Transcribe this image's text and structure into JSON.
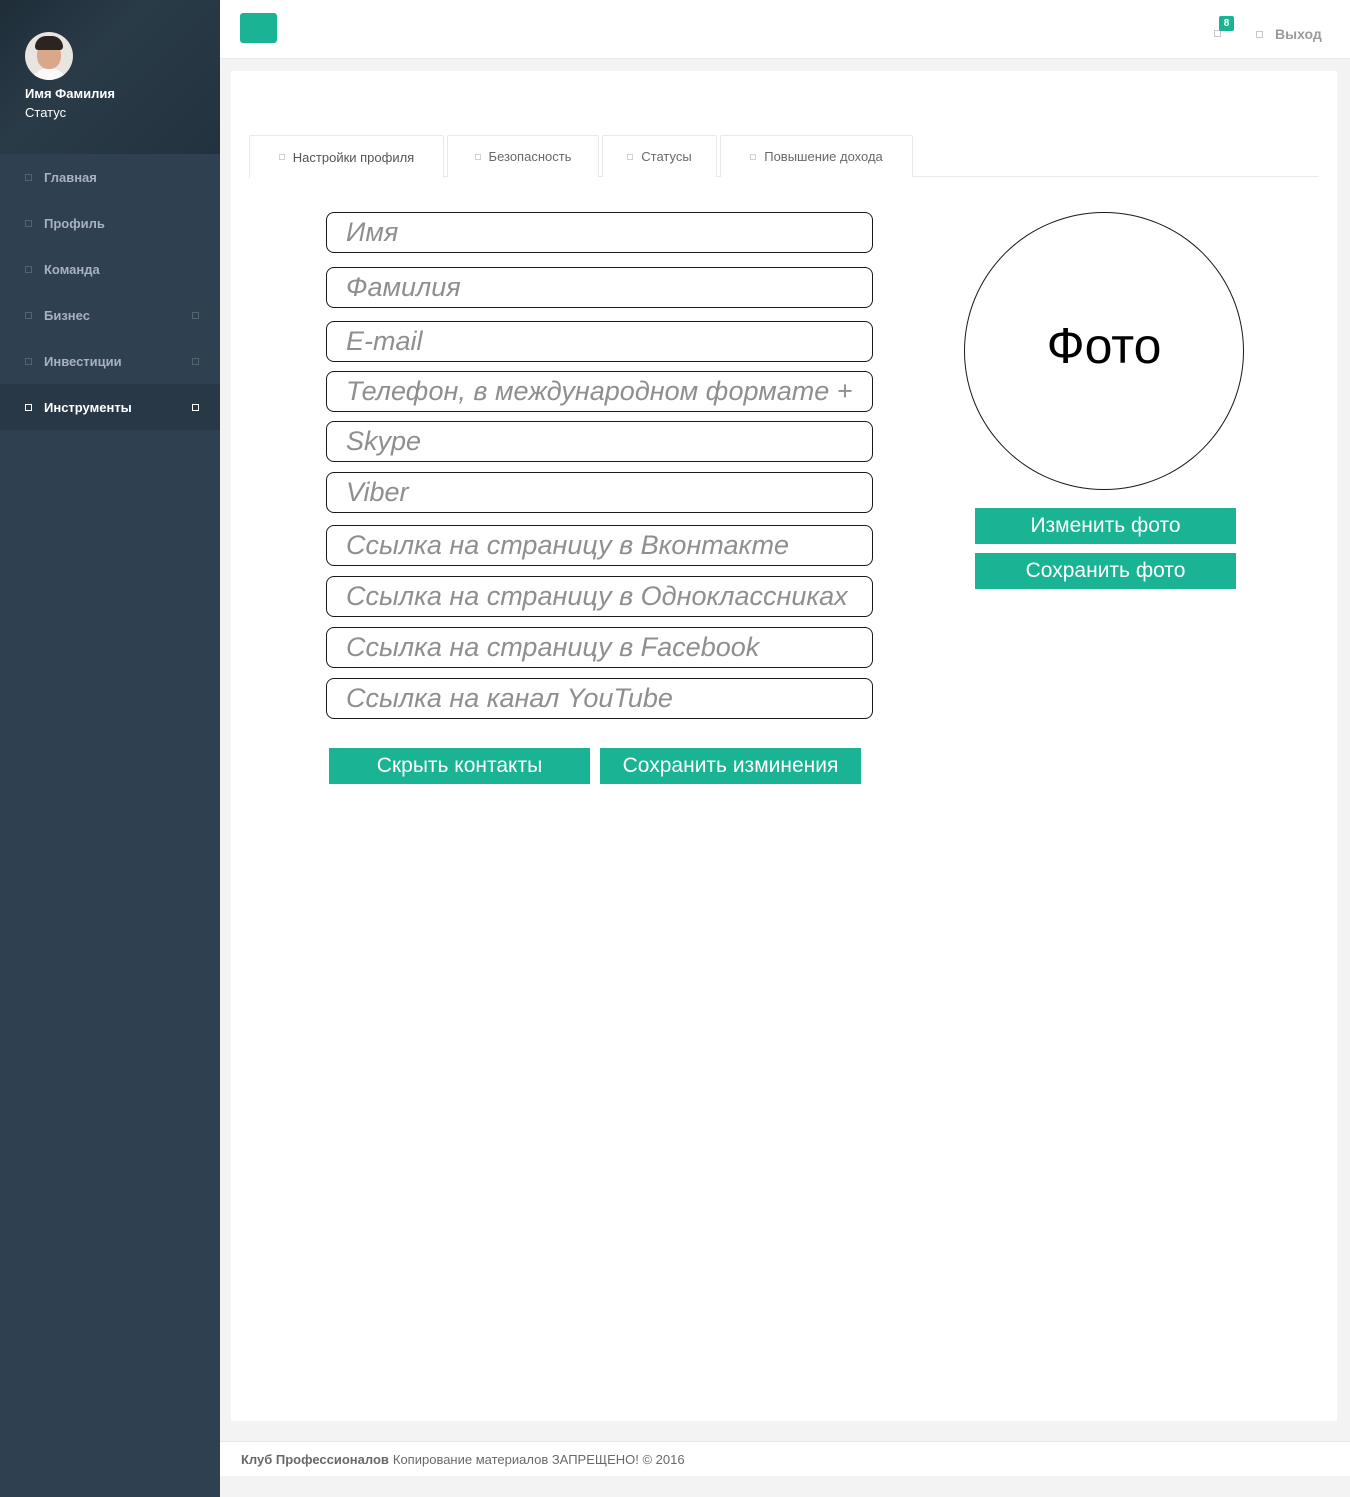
{
  "sidebar": {
    "user_name": "Имя Фамилия",
    "user_status": "Статус",
    "items": [
      {
        "label": "Главная"
      },
      {
        "label": "Профиль"
      },
      {
        "label": "Команда"
      },
      {
        "label": "Бизнес"
      },
      {
        "label": "Инвестиции"
      },
      {
        "label": "Инструменты"
      }
    ]
  },
  "topbar": {
    "notification_count": "8",
    "logout_label": "Выход"
  },
  "tabs": [
    {
      "label": "Настройки профиля"
    },
    {
      "label": "Безопасность"
    },
    {
      "label": "Статусы"
    },
    {
      "label": "Повышение дохода"
    }
  ],
  "form": {
    "fields": [
      {
        "placeholder": "Имя"
      },
      {
        "placeholder": "Фамилия"
      },
      {
        "placeholder": "E-mail"
      },
      {
        "placeholder": "Телефон, в международном формате +"
      },
      {
        "placeholder": "Skype"
      },
      {
        "placeholder": "Viber"
      },
      {
        "placeholder": "Ссылка на страницу в Вконтакте"
      },
      {
        "placeholder": "Ссылка на страницу в Одноклассниках"
      },
      {
        "placeholder": "Ссылка на страницу в Facebook"
      },
      {
        "placeholder": "Ссылка на канал YouTube"
      }
    ],
    "hide_contacts_label": "Скрыть контакты",
    "save_changes_label": "Сохранить изминения"
  },
  "photo": {
    "placeholder_label": "Фото",
    "change_label": "Изменить фото",
    "save_label": "Сохранить фото"
  },
  "footer": {
    "brand": "Клуб Профессионалов",
    "copyright": "Копирование материалов ЗАПРЕЩЕНО! © 2016"
  },
  "colors": {
    "accent": "#1ab394",
    "sidebar_bg": "#2f4050",
    "page_bg": "#f3f3f4"
  }
}
